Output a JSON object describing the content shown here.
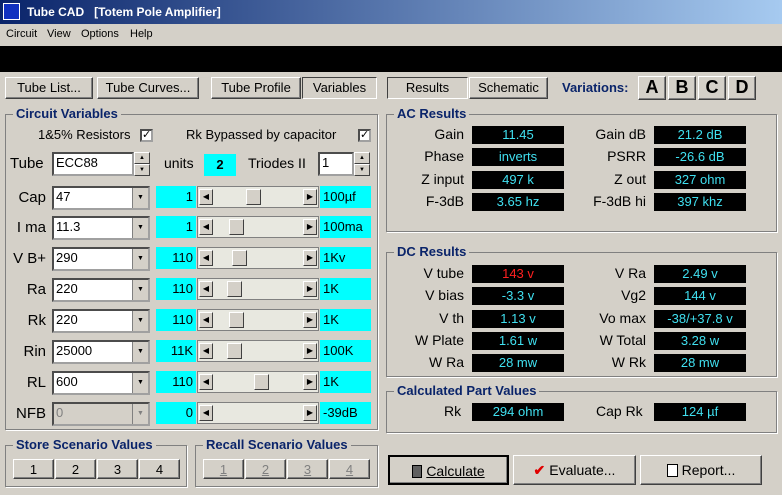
{
  "window": {
    "title": "Tube CAD   [Totem Pole Amplifier]"
  },
  "menu": [
    "Circuit",
    "View",
    "Options",
    "Help"
  ],
  "toolbar": {
    "tube_list": "Tube List...",
    "tube_curves": "Tube Curves...",
    "tube_profile": "Tube Profile",
    "variables": "Variables",
    "results": "Results",
    "schematic": "Schematic",
    "variations_label": "Variations:",
    "variations": [
      "A",
      "B",
      "C",
      "D"
    ]
  },
  "circuit_variables": {
    "title": "Circuit Variables",
    "resistors_label": "1&5% Resistors",
    "rk_bypassed_label": "Rk Bypassed by capacitor",
    "tube_label": "Tube",
    "tube_value": "ECC88",
    "units_label": "units",
    "units_value": "2",
    "triodes_label": "Triodes II",
    "triodes_value": "1",
    "rows": [
      {
        "label": "Cap",
        "value": "47",
        "mult": "1",
        "max": "100µf"
      },
      {
        "label": "I ma",
        "value": "11.3",
        "mult": "1",
        "max": "100ma"
      },
      {
        "label": "V B+",
        "value": "290",
        "mult": "110",
        "max": "1Kv"
      },
      {
        "label": "Ra",
        "value": "220",
        "mult": "110",
        "max": "1K"
      },
      {
        "label": "Rk",
        "value": "220",
        "mult": "110",
        "max": "1K"
      },
      {
        "label": "Rin",
        "value": "25000",
        "mult": "11K",
        "max": "100K"
      },
      {
        "label": "RL",
        "value": "600",
        "mult": "110",
        "max": "1K"
      },
      {
        "label": "NFB",
        "value": "0",
        "mult": "0",
        "max": "-39dB"
      }
    ],
    "slider_positions": [
      0.44,
      0.2,
      0.25,
      0.18,
      0.2,
      0.18,
      0.55,
      0.0
    ]
  },
  "store": {
    "title": "Store Scenario Values",
    "buttons": [
      "1",
      "2",
      "3",
      "4"
    ]
  },
  "recall": {
    "title": "Recall Scenario Values",
    "buttons": [
      "1",
      "2",
      "3",
      "4"
    ]
  },
  "ac_results": {
    "title": "AC Results",
    "left": [
      {
        "label": "Gain",
        "value": "11.45"
      },
      {
        "label": "Phase",
        "value": "inverts"
      },
      {
        "label": "Z input",
        "value": "497 k"
      },
      {
        "label": "F-3dB",
        "value": "3.65 hz"
      }
    ],
    "right": [
      {
        "label": "Gain dB",
        "value": "21.2 dB"
      },
      {
        "label": "PSRR",
        "value": "-26.6 dB"
      },
      {
        "label": "Z out",
        "value": "327 ohm"
      },
      {
        "label": "F-3dB hi",
        "value": "397 khz"
      }
    ]
  },
  "dc_results": {
    "title": "DC Results",
    "left": [
      {
        "label": "V tube",
        "value": "143 v",
        "color": "#ff2020"
      },
      {
        "label": "V bias",
        "value": "-3.3 v"
      },
      {
        "label": "V th",
        "value": "1.13 v"
      },
      {
        "label": "W Plate",
        "value": "1.61 w"
      },
      {
        "label": "W Ra",
        "value": "28 mw"
      }
    ],
    "right": [
      {
        "label": "V Ra",
        "value": "2.49 v"
      },
      {
        "label": "Vg2",
        "value": "144 v"
      },
      {
        "label": "Vo max",
        "value": "-38/+37.8 v"
      },
      {
        "label": "W Total",
        "value": "3.28 w"
      },
      {
        "label": "W Rk",
        "value": "28 mw"
      }
    ]
  },
  "part_values": {
    "title": "Calculated Part Values",
    "rk_label": "Rk",
    "rk_value": "294 ohm",
    "caprk_label": "Cap Rk",
    "caprk_value": "124 µf"
  },
  "actions": {
    "calculate": "Calculate",
    "evaluate": "Evaluate...",
    "report": "Report..."
  },
  "colors": {
    "display_text": "#40e0f0",
    "accent": "#0a246a",
    "cyan_field": "#00ffff"
  }
}
